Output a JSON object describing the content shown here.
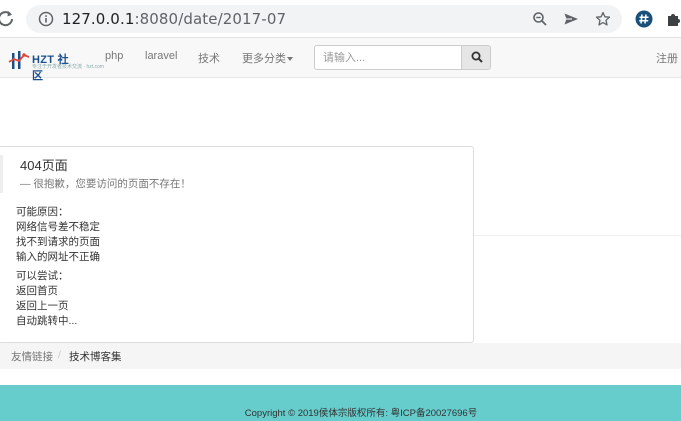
{
  "browser": {
    "url_host": "127.0.0.1",
    "url_rest": ":8080/date/2017-07"
  },
  "navbar": {
    "logo_text": "HZT 社区",
    "logo_sub": "专注于开发者技术交流 · hzt.com",
    "items": [
      {
        "label": "php"
      },
      {
        "label": "laravel"
      },
      {
        "label": "技术"
      },
      {
        "label": "更多分类"
      }
    ],
    "search_placeholder": "请输入...",
    "register_label": "注册"
  },
  "error_page": {
    "title": "404页面",
    "subtitle": "— 很抱歉，您要访问的页面不存在！",
    "reasons_heading": "可能原因：",
    "reasons": [
      "网络信号差不稳定",
      "找不到请求的页面",
      "输入的网址不正确"
    ],
    "tries_heading": "可以尝试：",
    "tries": [
      "返回首页",
      "返回上一页",
      "自动跳转中..."
    ]
  },
  "friend_links": {
    "label": "友情链接",
    "separator": "/",
    "links": [
      "技术博客集"
    ]
  },
  "footer": {
    "copyright": "Copyright © 2019侯体宗版权所有: 粤ICP备20027696号"
  }
}
